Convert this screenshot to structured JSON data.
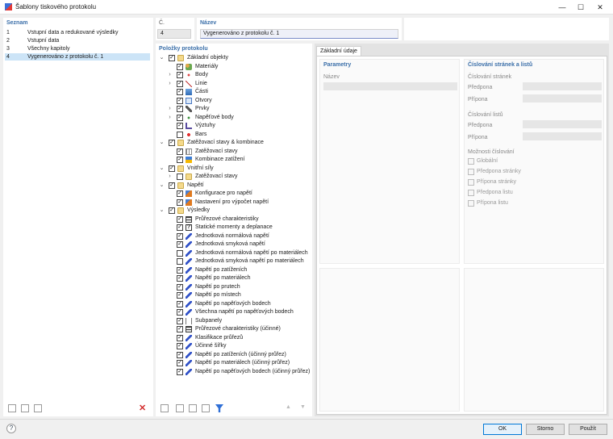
{
  "window": {
    "title": "Šablony tiskového protokolu",
    "minimize": "—",
    "maximize": "☐",
    "close": "✕"
  },
  "seznam": {
    "header": "Seznam",
    "items": [
      {
        "num": "1",
        "label": "Vstupní data a redukované výsledky"
      },
      {
        "num": "2",
        "label": "Vstupní data"
      },
      {
        "num": "3",
        "label": "Všechny kapitoly"
      },
      {
        "num": "4",
        "label": "Vygenerováno z protokolu č. 1"
      }
    ],
    "selected_index": 3
  },
  "cislo": {
    "label": "Č.",
    "value": "4"
  },
  "nazev": {
    "label": "Název",
    "value": "Vygenerováno z protokolu č. 1"
  },
  "polozky": {
    "header": "Položky protokolu",
    "rows": [
      {
        "level": 0,
        "toggle": "v",
        "checked": true,
        "icon": "folder",
        "label": "Základní objekty",
        "bold": true
      },
      {
        "level": 1,
        "toggle": "",
        "checked": true,
        "icon": "mat",
        "label": "Materiály"
      },
      {
        "level": 1,
        "toggle": ">",
        "checked": true,
        "icon": "dot",
        "label": "Body"
      },
      {
        "level": 1,
        "toggle": ">",
        "checked": true,
        "icon": "line",
        "label": "Linie"
      },
      {
        "level": 1,
        "toggle": "",
        "checked": true,
        "icon": "part",
        "label": "Části"
      },
      {
        "level": 1,
        "toggle": "",
        "checked": true,
        "icon": "open",
        "label": "Otvory"
      },
      {
        "level": 1,
        "toggle": ">",
        "checked": true,
        "icon": "prvk",
        "label": "Prvky"
      },
      {
        "level": 1,
        "toggle": ">",
        "checked": true,
        "icon": "nodep",
        "label": "Napěťové body"
      },
      {
        "level": 1,
        "toggle": "",
        "checked": true,
        "icon": "vyz",
        "label": "Výztuhy"
      },
      {
        "level": 1,
        "toggle": "",
        "checked": false,
        "icon": "bars",
        "label": "Bars"
      },
      {
        "level": 0,
        "toggle": "v",
        "checked": true,
        "icon": "folder",
        "label": "Zatěžovací stavy & kombinace"
      },
      {
        "level": 1,
        "toggle": "",
        "checked": true,
        "icon": "load",
        "label": "Zatěžovací stavy"
      },
      {
        "level": 1,
        "toggle": "",
        "checked": true,
        "icon": "comb",
        "label": "Kombinace zatížení"
      },
      {
        "level": 0,
        "toggle": "v",
        "checked": true,
        "icon": "folder",
        "label": "Vnitřní síly"
      },
      {
        "level": 1,
        "toggle": ">",
        "checked": false,
        "icon": "folder",
        "label": "Zatěžovací stavy"
      },
      {
        "level": 0,
        "toggle": "v",
        "checked": true,
        "icon": "folder",
        "label": "Napětí"
      },
      {
        "level": 1,
        "toggle": "",
        "checked": true,
        "icon": "cfg",
        "label": "Konfigurace pro napětí"
      },
      {
        "level": 1,
        "toggle": "",
        "checked": true,
        "icon": "cfg",
        "label": "Nastavení pro výpočet napětí"
      },
      {
        "level": 0,
        "toggle": "v",
        "checked": true,
        "icon": "folder",
        "label": "Výsledky"
      },
      {
        "level": 1,
        "toggle": "",
        "checked": true,
        "icon": "table",
        "label": "Průřezové charakteristiky"
      },
      {
        "level": 1,
        "toggle": "",
        "checked": true,
        "icon": "q",
        "label": "Statické momenty a deplanace"
      },
      {
        "level": 1,
        "toggle": "",
        "checked": true,
        "icon": "str",
        "label": "Jednotková normálová napětí"
      },
      {
        "level": 1,
        "toggle": "",
        "checked": true,
        "icon": "str",
        "label": "Jednotková smyková napětí"
      },
      {
        "level": 1,
        "toggle": "",
        "checked": false,
        "icon": "str",
        "label": "Jednotková normálová napětí po materiálech"
      },
      {
        "level": 1,
        "toggle": "",
        "checked": false,
        "icon": "str",
        "label": "Jednotková smyková napětí po materiálech"
      },
      {
        "level": 1,
        "toggle": "",
        "checked": true,
        "icon": "str",
        "label": "Napětí po zatíženích"
      },
      {
        "level": 1,
        "toggle": "",
        "checked": true,
        "icon": "str",
        "label": "Napětí po materiálech"
      },
      {
        "level": 1,
        "toggle": "",
        "checked": true,
        "icon": "str",
        "label": "Napětí po prutech"
      },
      {
        "level": 1,
        "toggle": "",
        "checked": true,
        "icon": "str",
        "label": "Napětí po místech"
      },
      {
        "level": 1,
        "toggle": "",
        "checked": true,
        "icon": "str",
        "label": "Napětí po napěťových bodech"
      },
      {
        "level": 1,
        "toggle": "",
        "checked": true,
        "icon": "str",
        "label": "Všechna napětí po napěťových bodech"
      },
      {
        "level": 1,
        "toggle": "",
        "checked": true,
        "icon": "sub",
        "label": "Subpanely"
      },
      {
        "level": 1,
        "toggle": "",
        "checked": true,
        "icon": "table",
        "label": "Průřezové charakteristiky (účinné)"
      },
      {
        "level": 1,
        "toggle": "",
        "checked": true,
        "icon": "str",
        "label": "Klasifikace průřezů"
      },
      {
        "level": 1,
        "toggle": "",
        "checked": true,
        "icon": "str",
        "label": "Účinné šířky"
      },
      {
        "level": 1,
        "toggle": "",
        "checked": true,
        "icon": "str",
        "label": "Napětí po zatíženích (účinný průřez)"
      },
      {
        "level": 1,
        "toggle": "",
        "checked": true,
        "icon": "str",
        "label": "Napětí po materiálech (účinný průřez)"
      },
      {
        "level": 1,
        "toggle": "",
        "checked": true,
        "icon": "str",
        "label": "Napětí po napěťových bodech (účinný průřez)"
      }
    ]
  },
  "tab": {
    "label": "Základní údaje"
  },
  "parametry": {
    "header": "Parametry",
    "nazev_label": "Název"
  },
  "cislovani": {
    "header": "Číslování stránek a listů",
    "stranky_label": "Číslování stránek",
    "listy_label": "Číslování listů",
    "predpona": "Předpona",
    "pripona": "Přípona",
    "moznosti_label": "Možnosti číslování",
    "options": [
      "Globální",
      "Předpona stránky",
      "Přípona stránky",
      "Předpona listu",
      "Přípona listu"
    ]
  },
  "buttons": {
    "ok": "OK",
    "storno": "Storno",
    "pouzit": "Použít"
  },
  "nav": {
    "up": "▲",
    "down": "▼"
  },
  "icons": {
    "checkmark": "✓",
    "delete": "✕",
    "help": "?"
  },
  "colors": {
    "accent": "#3b6fa9",
    "selection": "#cce4f7",
    "delete_red": "#d32f2f",
    "filter_blue": "#2f6fd6"
  }
}
